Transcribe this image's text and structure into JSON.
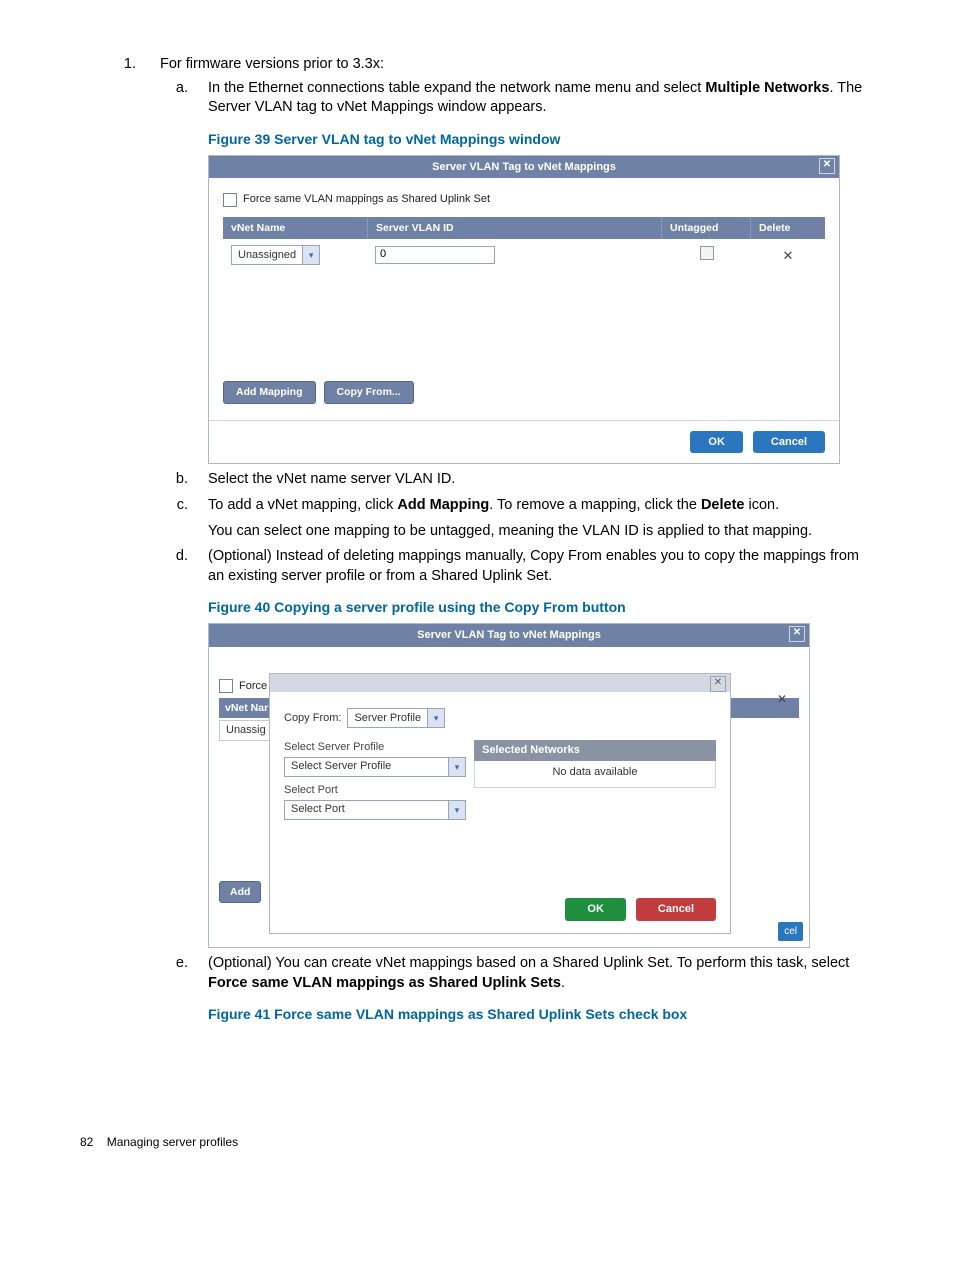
{
  "text": {
    "step1": "For firmware versions prior to 3.3x:",
    "step_a_pre": "In the Ethernet connections table expand the network name menu and select ",
    "step_a_bold": "Multiple Networks",
    "step_a_post": ". The Server VLAN tag to vNet Mappings window appears.",
    "fig39": "Figure 39 Server VLAN tag to vNet Mappings window",
    "step_b": "Select the vNet name server VLAN ID.",
    "step_c_pre": "To add a vNet mapping, click ",
    "step_c_b1": "Add Mapping",
    "step_c_mid": ". To remove a mapping, click the ",
    "step_c_b2": "Delete",
    "step_c_post": " icon.",
    "step_c_note": "You can select one mapping to be untagged, meaning the VLAN ID is applied to that mapping.",
    "step_d": "(Optional) Instead of deleting mappings manually, Copy From enables you to copy the mappings from an existing server profile or from a Shared Uplink Set.",
    "fig40": "Figure 40 Copying a server profile using the Copy From button",
    "step_e_pre": "(Optional) You can create vNet mappings based on a Shared Uplink Set. To perform this task, select ",
    "step_e_bold": "Force same VLAN mappings as Shared Uplink Sets",
    "step_e_post": ".",
    "fig41": "Figure 41 Force same VLAN mappings as Shared Uplink Sets check box"
  },
  "dlg39": {
    "title": "Server VLAN Tag to vNet Mappings",
    "close": "✕",
    "force_label": "Force same VLAN mappings as Shared Uplink Set",
    "col_vnet": "vNet Name",
    "col_svlan": "Server VLAN ID",
    "col_untag": "Untagged",
    "col_delete": "Delete",
    "row0_vnet": "Unassigned",
    "row0_svlan": "0",
    "row0_del": "✕",
    "btn_add": "Add Mapping",
    "btn_copy": "Copy From...",
    "btn_ok": "OK",
    "btn_cancel": "Cancel"
  },
  "dlg40": {
    "outer_title": "Server VLAN Tag to vNet Mappings",
    "outer_close": "✕",
    "bg_force": "Force",
    "bg_vnet": "vNet Nar",
    "bg_unassigned": "Unassig",
    "bg_add": "Add",
    "bg_cel": "cel",
    "bg_x": "✕",
    "inner_close": "✕",
    "copy_from_lbl": "Copy From:",
    "copy_from_val": "Server Profile",
    "sel_prof_lbl": "Select Server Profile",
    "sel_prof_val": "Select Server Profile",
    "sel_port_lbl": "Select Port",
    "sel_port_val": "Select Port",
    "sel_net_head": "Selected Networks",
    "sel_net_body": "No data available",
    "btn_ok": "OK",
    "btn_cancel": "Cancel"
  },
  "footer": {
    "page": "82",
    "section": "Managing server profiles"
  },
  "glyphs": {
    "chev_down": "▾"
  }
}
